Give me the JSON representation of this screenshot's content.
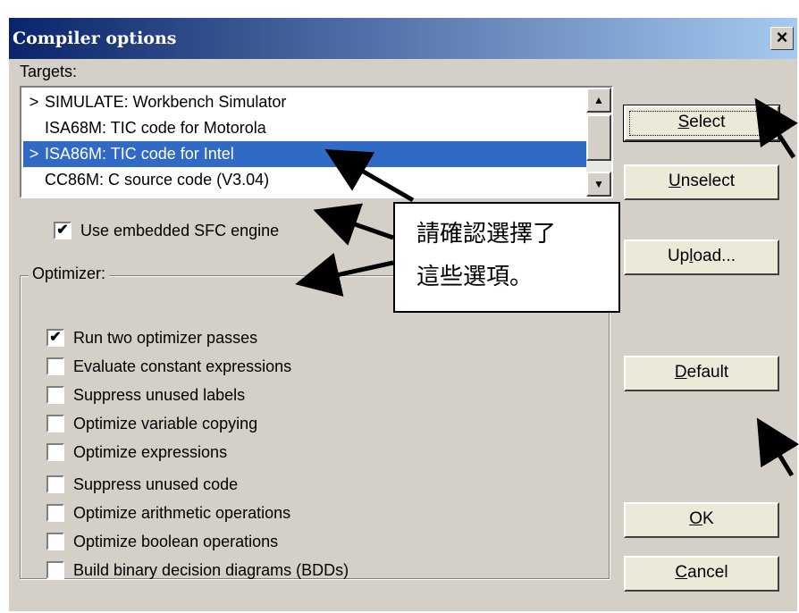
{
  "dialog": {
    "title": "Compiler options",
    "close_icon": "×"
  },
  "targets": {
    "label": "Targets:",
    "items": [
      {
        "marker": ">",
        "text": "SIMULATE: Workbench Simulator",
        "selected": false
      },
      {
        "marker": "",
        "text": "ISA68M: TIC code for Motorola",
        "selected": false
      },
      {
        "marker": ">",
        "text": "ISA86M: TIC code for Intel",
        "selected": true
      },
      {
        "marker": "",
        "text": "CC86M: C source code (V3.04)",
        "selected": false
      }
    ]
  },
  "embedded_sfc": {
    "label": "Use embedded SFC engine",
    "checked": true
  },
  "optimizer": {
    "label": "Optimizer:",
    "options": [
      {
        "label": "Run two optimizer passes",
        "checked": true
      },
      {
        "label": "Evaluate constant expressions",
        "checked": false
      },
      {
        "label": "Suppress unused labels",
        "checked": false
      },
      {
        "label": "Optimize variable copying",
        "checked": false
      },
      {
        "label": "Optimize expressions",
        "checked": false
      },
      {
        "label": "Suppress unused code",
        "checked": false
      },
      {
        "label": "Optimize arithmetic operations",
        "checked": false
      },
      {
        "label": "Optimize boolean operations",
        "checked": false
      },
      {
        "label": "Build binary decision diagrams (BDDs)",
        "checked": false
      }
    ]
  },
  "buttons": {
    "select": {
      "pre": "",
      "key": "S",
      "post": "elect"
    },
    "unselect": {
      "pre": "",
      "key": "U",
      "post": "nselect"
    },
    "upload": {
      "pre": "Up",
      "key": "l",
      "post": "oad..."
    },
    "default": {
      "pre": "",
      "key": "D",
      "post": "efault"
    },
    "ok": {
      "pre": "",
      "key": "O",
      "post": "K"
    },
    "cancel": {
      "pre": "",
      "key": "C",
      "post": "ancel"
    }
  },
  "annotation": {
    "line1": "請確認選擇了",
    "line2": "這些選項。"
  },
  "colors": {
    "titlebar_start": "#0a246a",
    "titlebar_end": "#a6caf0",
    "selection": "#316ac5",
    "face": "#d4d0c8"
  }
}
